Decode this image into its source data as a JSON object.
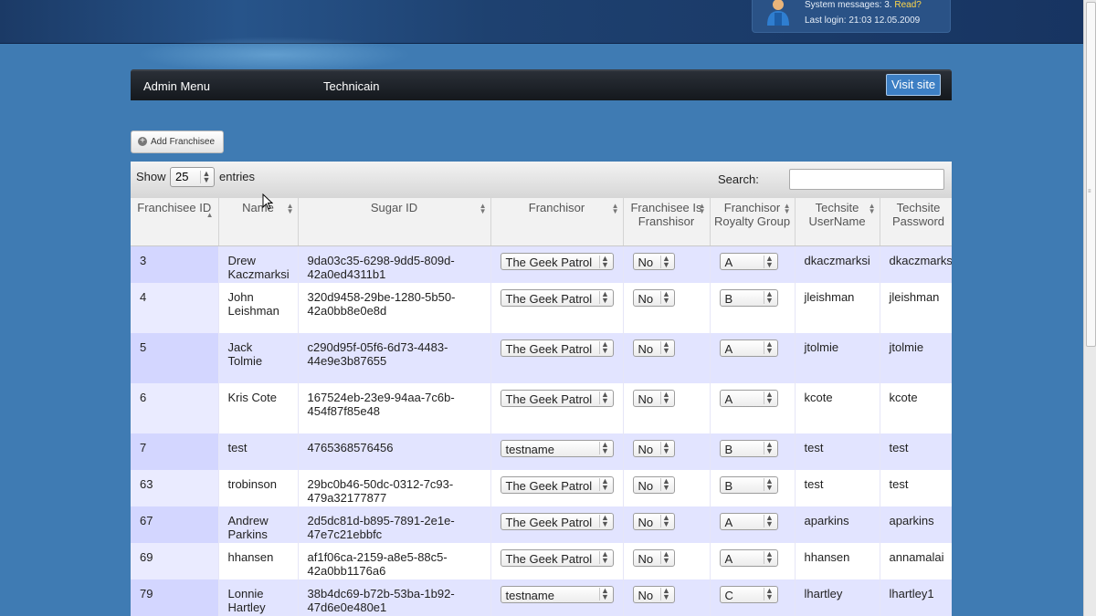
{
  "header": {
    "system_messages_label": "System messages: 3.",
    "read_link": "Read?",
    "last_login": "Last login: 21:03 12.05.2009"
  },
  "nav": {
    "admin_menu": "Admin Menu",
    "technicain": "Technicain",
    "visit_site": "Visit site"
  },
  "toolbar": {
    "add_franchisee": "Add Franchisee"
  },
  "table_controls": {
    "show_label": "Show",
    "page_length": "25",
    "entries_label": "entries",
    "search_label": "Search:",
    "search_value": ""
  },
  "columns": [
    "Franchisee ID",
    "Name",
    "Sugar ID",
    "Franchisor",
    "Franchisee Is Franshisor",
    "Franchisor Royalty Group",
    "Techsite UserName",
    "Techsite Password"
  ],
  "rows": [
    {
      "id": "3",
      "name": "Drew Kaczmarksi",
      "sugar_id": "9da03c35-6298-9dd5-809d-42a0ed4311b1",
      "franchisor": "The Geek Patrol",
      "is_franchisor": "No",
      "royalty_group": "A",
      "username": "dkaczmarksi",
      "password": "dkaczmarksi"
    },
    {
      "id": "4",
      "name": "John Leishman",
      "sugar_id": "320d9458-29be-1280-5b50-42a0bb8e0e8d",
      "franchisor": "The Geek Patrol",
      "is_franchisor": "No",
      "royalty_group": "B",
      "username": "jleishman",
      "password": "jleishman"
    },
    {
      "id": "5",
      "name": "Jack Tolmie",
      "sugar_id": "c290d95f-05f6-6d73-4483-44e9e3b87655",
      "franchisor": "The Geek Patrol",
      "is_franchisor": "No",
      "royalty_group": "A",
      "username": "jtolmie",
      "password": "jtolmie"
    },
    {
      "id": "6",
      "name": "Kris Cote",
      "sugar_id": "167524eb-23e9-94aa-7c6b-454f87f85e48",
      "franchisor": "The Geek Patrol",
      "is_franchisor": "No",
      "royalty_group": "A",
      "username": "kcote",
      "password": "kcote"
    },
    {
      "id": "7",
      "name": "test",
      "sugar_id": "4765368576456",
      "franchisor": "testname",
      "is_franchisor": "No",
      "royalty_group": "B",
      "username": "test",
      "password": "test"
    },
    {
      "id": "63",
      "name": "trobinson",
      "sugar_id": "29bc0b46-50dc-0312-7c93-479a32177877",
      "franchisor": "The Geek Patrol",
      "is_franchisor": "No",
      "royalty_group": "B",
      "username": "test",
      "password": "test"
    },
    {
      "id": "67",
      "name": "Andrew Parkins",
      "sugar_id": "2d5dc81d-b895-7891-2e1e-47e7c21ebbfc",
      "franchisor": "The Geek Patrol",
      "is_franchisor": "No",
      "royalty_group": "A",
      "username": "aparkins",
      "password": "aparkins"
    },
    {
      "id": "69",
      "name": "hhansen",
      "sugar_id": "af1f06ca-2159-a8e5-88c5-42a0bb1176a6",
      "franchisor": "The Geek Patrol",
      "is_franchisor": "No",
      "royalty_group": "A",
      "username": "hhansen",
      "password": "annamalai"
    },
    {
      "id": "79",
      "name": "Lonnie Hartley",
      "sugar_id": "38b4dc69-b72b-53ba-1b92-47d6e0e480e1",
      "franchisor": "testname",
      "is_franchisor": "No",
      "royalty_group": "C",
      "username": "lhartley",
      "password": "lhartley1"
    }
  ]
}
